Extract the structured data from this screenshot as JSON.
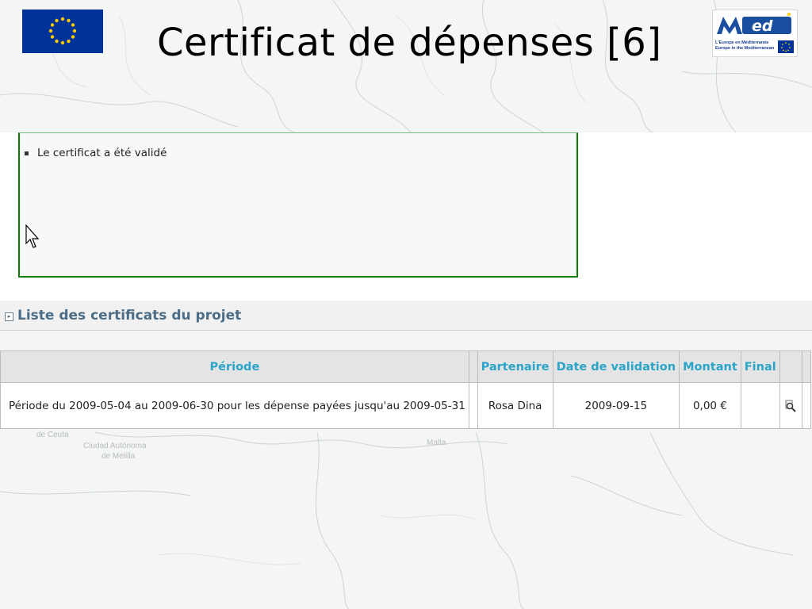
{
  "slide": {
    "title": "Certificat de dépenses [6]",
    "logo_text": "ed",
    "logo_tagline_1": "L'Europe en Méditerranée",
    "logo_tagline_2": "Europe in the Mediterranean"
  },
  "message": {
    "text": "Le certificat a été validé"
  },
  "section": {
    "icon_glyph": "▸",
    "title": "Liste des certificats du projet"
  },
  "table": {
    "headers": [
      "Période",
      "",
      "Partenaire",
      "Date de validation",
      "Montant",
      "Final",
      "",
      ""
    ],
    "rows": [
      {
        "periode": "Période du 2009-05-04 au 2009-06-30 pour les dépense payées jusqu'au 2009-05-31",
        "partenaire": "Rosa Dina",
        "date_validation": "2009-09-15",
        "montant": "0,00 €",
        "final": ""
      }
    ]
  },
  "map_labels": {
    "ceuta": "de Ceuta",
    "melilla_1": "Ciudad Autónoma",
    "melilla_2": "de Melilla",
    "malta": "Malta"
  },
  "icons": {
    "view": "magnifier-icon",
    "section": "expand-icon",
    "cursor": "mouse-cursor-icon"
  },
  "colors": {
    "header_text": "#2aa4c8",
    "section_title": "#4d6d86",
    "message_border": "#0b7d0b",
    "eu_blue": "#003399",
    "eu_star": "#ffcc00"
  }
}
